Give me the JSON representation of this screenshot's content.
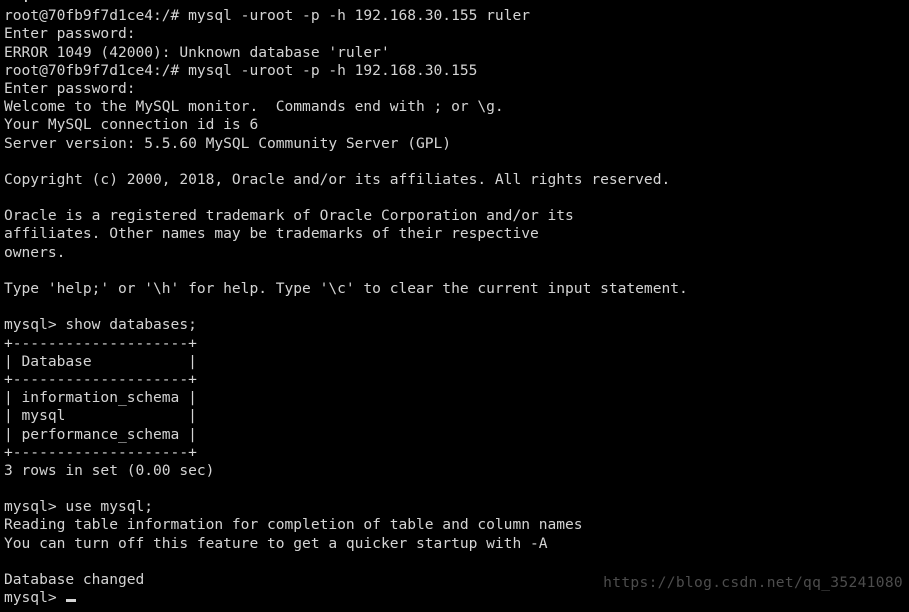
{
  "terminal": {
    "background_color": "#000000",
    "foreground_color": "#d4d4d4",
    "watermark_color": "#4d4d4d",
    "hostname": "70fb9f7d1ce4",
    "user": "root",
    "cwd": "/",
    "shell_prompt": "root@70fb9f7d1ce4:/#",
    "mysql_prompt": "mysql>",
    "server_host": "192.168.30.155",
    "server_version": "5.5.60 MySQL Community Server (GPL)",
    "connection_id": "6",
    "current_database": "mysql",
    "lines": [
      "  .                                                           ",
      "root@70fb9f7d1ce4:/# mysql -uroot -p -h 192.168.30.155 ruler",
      "Enter password:",
      "ERROR 1049 (42000): Unknown database 'ruler'",
      "root@70fb9f7d1ce4:/# mysql -uroot -p -h 192.168.30.155",
      "Enter password:",
      "Welcome to the MySQL monitor.  Commands end with ; or \\g.",
      "Your MySQL connection id is 6",
      "Server version: 5.5.60 MySQL Community Server (GPL)",
      "",
      "Copyright (c) 2000, 2018, Oracle and/or its affiliates. All rights reserved.",
      "",
      "Oracle is a registered trademark of Oracle Corporation and/or its",
      "affiliates. Other names may be trademarks of their respective",
      "owners.",
      "",
      "Type 'help;' or '\\h' for help. Type '\\c' to clear the current input statement.",
      "",
      "mysql> show databases;",
      "+--------------------+",
      "| Database           |",
      "+--------------------+",
      "| information_schema |",
      "| mysql              |",
      "| performance_schema |",
      "+--------------------+",
      "3 rows in set (0.00 sec)",
      "",
      "mysql> use mysql;",
      "Reading table information for completion of table and column names",
      "You can turn off this feature to get a quicker startup with -A",
      "",
      "Database changed"
    ],
    "prompt_line": "mysql> ",
    "watermark": "https://blog.csdn.net/qq_35241080",
    "commands": [
      "mysql -uroot -p -h 192.168.30.155 ruler",
      "mysql -uroot -p -h 192.168.30.155",
      "show databases;",
      "use mysql;"
    ],
    "error": {
      "code": "1049",
      "sqlstate": "42000",
      "message": "Unknown database 'ruler'"
    },
    "databases_table": {
      "header": "Database",
      "rows": [
        "information_schema",
        "mysql",
        "performance_schema"
      ],
      "row_count_text": "3 rows in set (0.00 sec)"
    }
  }
}
